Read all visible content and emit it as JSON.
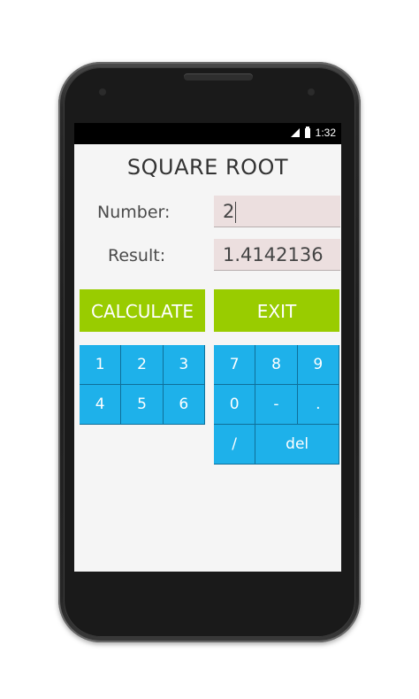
{
  "status_bar": {
    "time": "1:32"
  },
  "app": {
    "title": "SQUARE ROOT",
    "number_label": "Number:",
    "number_value": "2",
    "result_label": "Result:",
    "result_value": "1.4142136",
    "calculate_label": "CALCULATE",
    "exit_label": "EXIT"
  },
  "keypad_left": [
    "1",
    "2",
    "3",
    "4",
    "5",
    "6"
  ],
  "keypad_right": [
    "7",
    "8",
    "9",
    "0",
    "-",
    ".",
    "/",
    "del"
  ],
  "colors": {
    "green_button": "#99cc00",
    "key_blue": "#1eb1ea",
    "field_bg": "#ecdfdf",
    "screen_bg": "#f5f5f5"
  },
  "icons": [
    "signal-icon",
    "battery-icon"
  ]
}
